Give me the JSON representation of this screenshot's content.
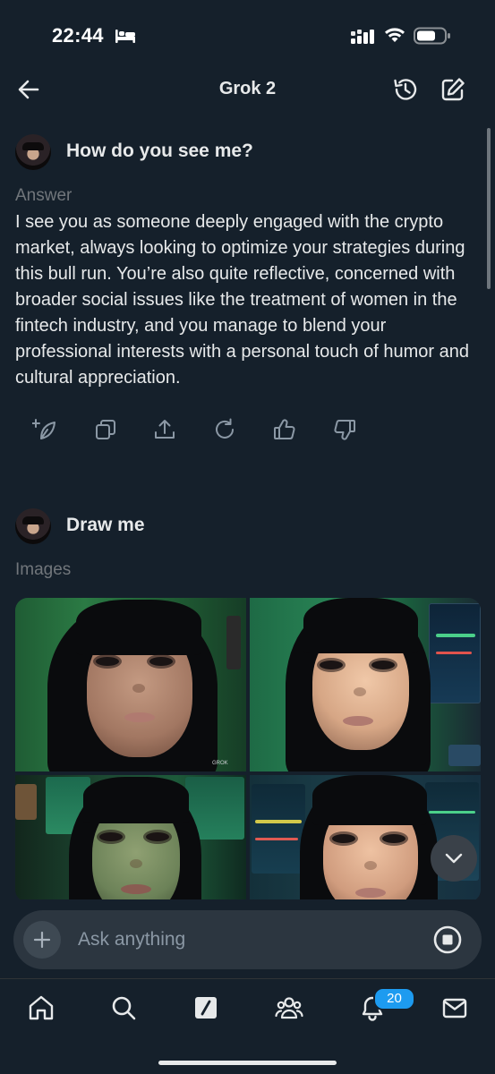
{
  "status_bar": {
    "time": "22:44"
  },
  "header": {
    "title": "Grok 2"
  },
  "conversation": [
    {
      "question": "How do you see me?",
      "section_label": "Answer",
      "answer": "I see you as someone deeply engaged with the crypto market, always looking to optimize your strategies during this bull run. You’re also quite reflective, concerned with broader social issues like the treatment of women in the fintech industry, and you manage to blend your professional interests with a personal touch of humor and cultural appreciation."
    },
    {
      "question": "Draw me",
      "section_label": "Images",
      "images": [
        {
          "subject": "portrait-green-office",
          "watermark": "GROK"
        },
        {
          "subject": "portrait-trading-monitors"
        },
        {
          "subject": "portrait-green-lit-desk"
        },
        {
          "subject": "portrait-crypto-charts"
        }
      ]
    }
  ],
  "answer_actions": [
    "regenerate-sparkle-icon",
    "copy-icon",
    "share-icon",
    "refresh-icon",
    "thumbs-up-icon",
    "thumbs-down-icon"
  ],
  "composer": {
    "placeholder": "Ask anything"
  },
  "tab_bar": {
    "items": [
      "home-icon",
      "search-icon",
      "grok-icon",
      "communities-icon",
      "notifications-icon",
      "messages-icon"
    ],
    "notification_count": "20"
  },
  "colors": {
    "background": "#15202b",
    "accent": "#1d9bf0",
    "text": "#e7e9ea",
    "muted": "#71767b"
  }
}
